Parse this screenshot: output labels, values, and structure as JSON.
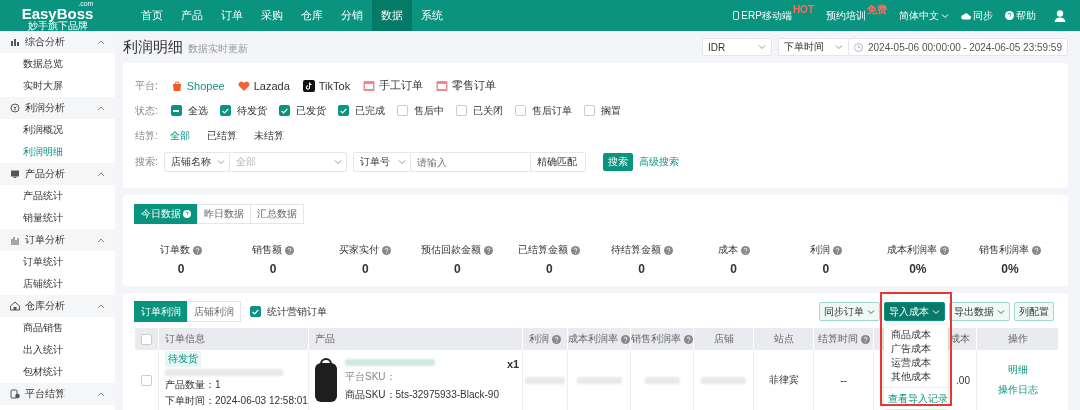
{
  "header": {
    "logo": "EasyBoss",
    "logo_suffix": ".com",
    "tagline": "妙手旗下品牌",
    "nav": [
      {
        "label": "首页",
        "selected": false
      },
      {
        "label": "产品",
        "selected": false
      },
      {
        "label": "订单",
        "selected": false
      },
      {
        "label": "采购",
        "selected": false
      },
      {
        "label": "仓库",
        "selected": false
      },
      {
        "label": "分销",
        "selected": false
      },
      {
        "label": "数据",
        "selected": true
      },
      {
        "label": "系统",
        "selected": false
      }
    ],
    "tools": [
      {
        "kind": "mobile",
        "label": "ERP移动端",
        "badge": "HOT"
      },
      {
        "kind": "plain",
        "label": "预约培训",
        "badge": "免费"
      },
      {
        "kind": "dropdown",
        "label": "简体中文"
      },
      {
        "kind": "sync",
        "label": "同步"
      },
      {
        "kind": "help",
        "label": "帮助"
      },
      {
        "kind": "user"
      }
    ]
  },
  "sidebar": {
    "groups": [
      {
        "title": "综合分析",
        "expanded": true,
        "items": [
          {
            "label": "数据总览",
            "selected": false
          },
          {
            "label": "实时大屏",
            "selected": false
          }
        ]
      },
      {
        "title": "利润分析",
        "expanded": true,
        "items": [
          {
            "label": "利润概况",
            "selected": false
          },
          {
            "label": "利润明细",
            "selected": true
          }
        ]
      },
      {
        "title": "产品分析",
        "expanded": true,
        "items": [
          {
            "label": "产品统计",
            "selected": false
          },
          {
            "label": "销量统计",
            "selected": false
          }
        ]
      },
      {
        "title": "订单分析",
        "expanded": true,
        "items": [
          {
            "label": "订单统计",
            "selected": false
          },
          {
            "label": "店铺统计",
            "selected": false
          }
        ]
      },
      {
        "title": "仓库分析",
        "expanded": true,
        "items": [
          {
            "label": "商品销售",
            "selected": false
          },
          {
            "label": "出入统计",
            "selected": false
          },
          {
            "label": "包材统计",
            "selected": false
          }
        ]
      },
      {
        "title": "平台结算",
        "expanded": true
      }
    ]
  },
  "page": {
    "title": "利润明细",
    "subtitle": "数据实时更新",
    "currency": "IDR",
    "time_type": "下单时间",
    "date_start": "2024-05-06 00:00:00",
    "date_sep": "-",
    "date_end": "2024-06-05 23:59:59"
  },
  "filters": {
    "platform_label": "平台:",
    "platforms": [
      {
        "label": "Shopee",
        "selected": true
      },
      {
        "label": "Lazada",
        "selected": false
      },
      {
        "label": "TikTok",
        "selected": false
      },
      {
        "label": "手工订单",
        "selected": false
      },
      {
        "label": "零售订单",
        "selected": false
      }
    ],
    "status_label": "状态:",
    "statuses": [
      {
        "label": "全选",
        "kind": "select-all",
        "checked": true
      },
      {
        "label": "待发货",
        "kind": "option",
        "checked": true
      },
      {
        "label": "已发货",
        "kind": "option",
        "checked": true
      },
      {
        "label": "已完成",
        "kind": "option",
        "checked": true
      },
      {
        "label": "售后中",
        "kind": "option",
        "checked": false
      },
      {
        "label": "已关闭",
        "kind": "option",
        "checked": false
      },
      {
        "label": "售后订单",
        "kind": "option",
        "checked": false
      },
      {
        "label": "搁置",
        "kind": "option",
        "checked": false
      }
    ],
    "settle_label": "结算:",
    "settle_options": [
      {
        "label": "全部",
        "selected": true
      },
      {
        "label": "已结算",
        "selected": false
      },
      {
        "label": "未结算",
        "selected": false
      }
    ],
    "search_label": "搜索:",
    "store_field": "店铺名称",
    "store_placeholder": "全部",
    "order_field": "订单号",
    "order_placeholder": "请输入",
    "match_mode": "精确匹配",
    "search_button": "搜索",
    "advanced_link": "高级搜索"
  },
  "stats": {
    "tabs": [
      {
        "label": "今日数据",
        "selected": true,
        "help": true
      },
      {
        "label": "昨日数据",
        "selected": false,
        "help": false
      },
      {
        "label": "汇总数据",
        "selected": false,
        "help": false
      }
    ],
    "metrics": [
      {
        "label": "订单数",
        "value": "0"
      },
      {
        "label": "销售额",
        "value": "0"
      },
      {
        "label": "买家实付",
        "value": "0"
      },
      {
        "label": "预估回款金额",
        "value": "0"
      },
      {
        "label": "已结算金额",
        "value": "0"
      },
      {
        "label": "待结算金额",
        "value": "0"
      },
      {
        "label": "成本",
        "value": "0"
      },
      {
        "label": "利润",
        "value": "0"
      },
      {
        "label": "成本利润率",
        "value": "0%"
      },
      {
        "label": "销售利润率",
        "value": "0%"
      }
    ]
  },
  "table": {
    "tabs": [
      {
        "label": "订单利润",
        "selected": true
      },
      {
        "label": "店铺利润",
        "selected": false
      }
    ],
    "marketing_toggle": {
      "label": "统计营销订单",
      "checked": true
    },
    "actions": [
      {
        "label": "同步订单",
        "kind": "dropdown",
        "primary": false,
        "highlighted": false,
        "open": false
      },
      {
        "label": "导入成本",
        "kind": "dropdown",
        "primary": true,
        "highlighted": true,
        "open": true
      },
      {
        "label": "导出数据",
        "kind": "dropdown",
        "primary": false,
        "highlighted": false,
        "open": false
      },
      {
        "label": "列配置",
        "kind": "plain",
        "primary": false,
        "highlighted": false,
        "open": false
      }
    ],
    "menu": {
      "items": [
        "商品成本",
        "广告成本",
        "运营成本",
        "其他成本"
      ],
      "footer": "查看导入记录"
    },
    "select_all_checked": false,
    "columns": [
      {
        "label": "订单信息",
        "help": false
      },
      {
        "label": "产品",
        "help": false
      },
      {
        "label": "利润",
        "help": true
      },
      {
        "label": "成本利润率",
        "help": true
      },
      {
        "label": "销售利润率",
        "help": true
      },
      {
        "label": "店铺",
        "help": false
      },
      {
        "label": "站点",
        "help": false
      },
      {
        "label": "结算时间",
        "help": true
      },
      {
        "label": "成本",
        "help": false
      },
      {
        "label": "操作",
        "help": false
      }
    ],
    "rows": [
      {
        "checked": false,
        "status": "待发货",
        "quantity": "产品数量：1",
        "order_time": "下单时间：2024-06-03 12:58:01",
        "platform_sku": "平台SKU：",
        "product_sku": "商品SKU：5ts-32975933-Black-90",
        "count": "x1",
        "site": "菲律宾",
        "settle_time": "--",
        "cost": ".00",
        "actions": [
          "明细",
          "操作日志"
        ]
      }
    ]
  }
}
